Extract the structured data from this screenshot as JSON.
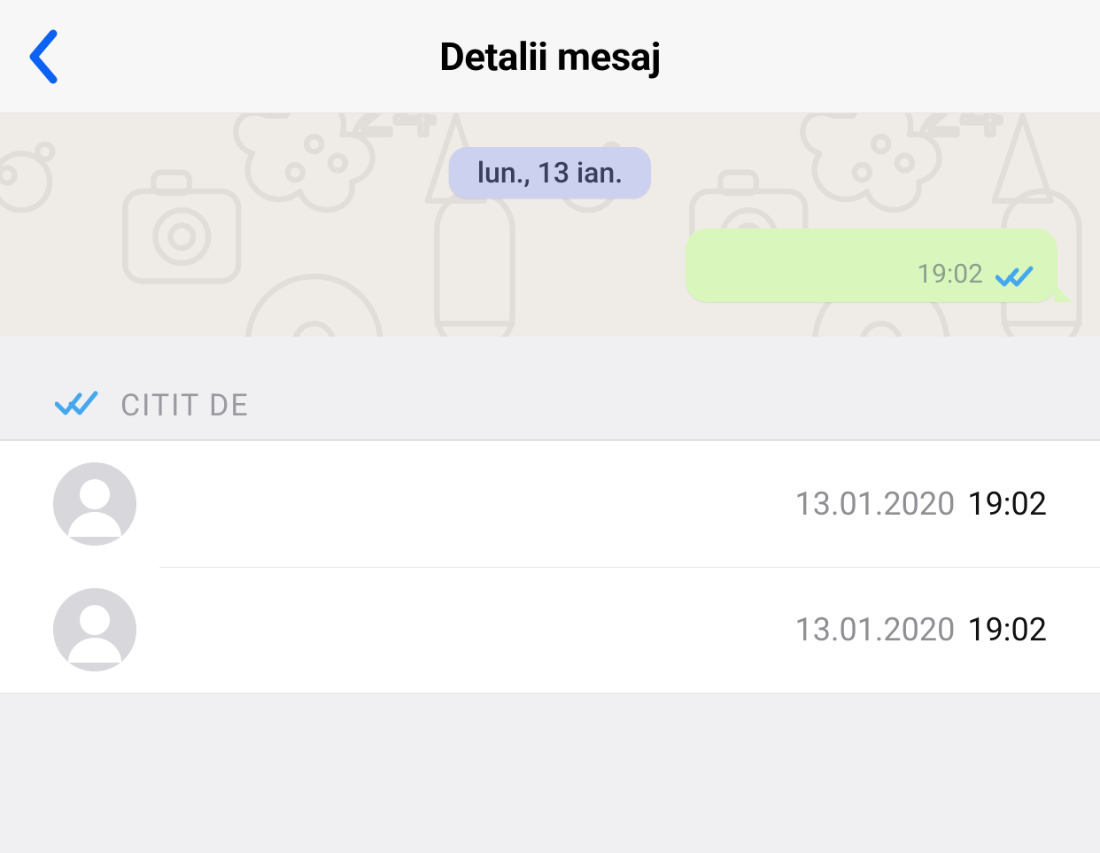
{
  "header": {
    "title": "Detalii mesaj"
  },
  "chat": {
    "date_label": "lun., 13 ian.",
    "bubble_time": "19:02"
  },
  "read_section": {
    "label": "CITIT DE",
    "readers": [
      {
        "date": "13.01.2020",
        "time": "19:02"
      },
      {
        "date": "13.01.2020",
        "time": "19:02"
      }
    ]
  },
  "colors": {
    "accent": "#0b62f4",
    "read_tick": "#45a8ee",
    "bubble_out": "#d9f7bc",
    "date_pill_bg": "#ccd1ef"
  }
}
